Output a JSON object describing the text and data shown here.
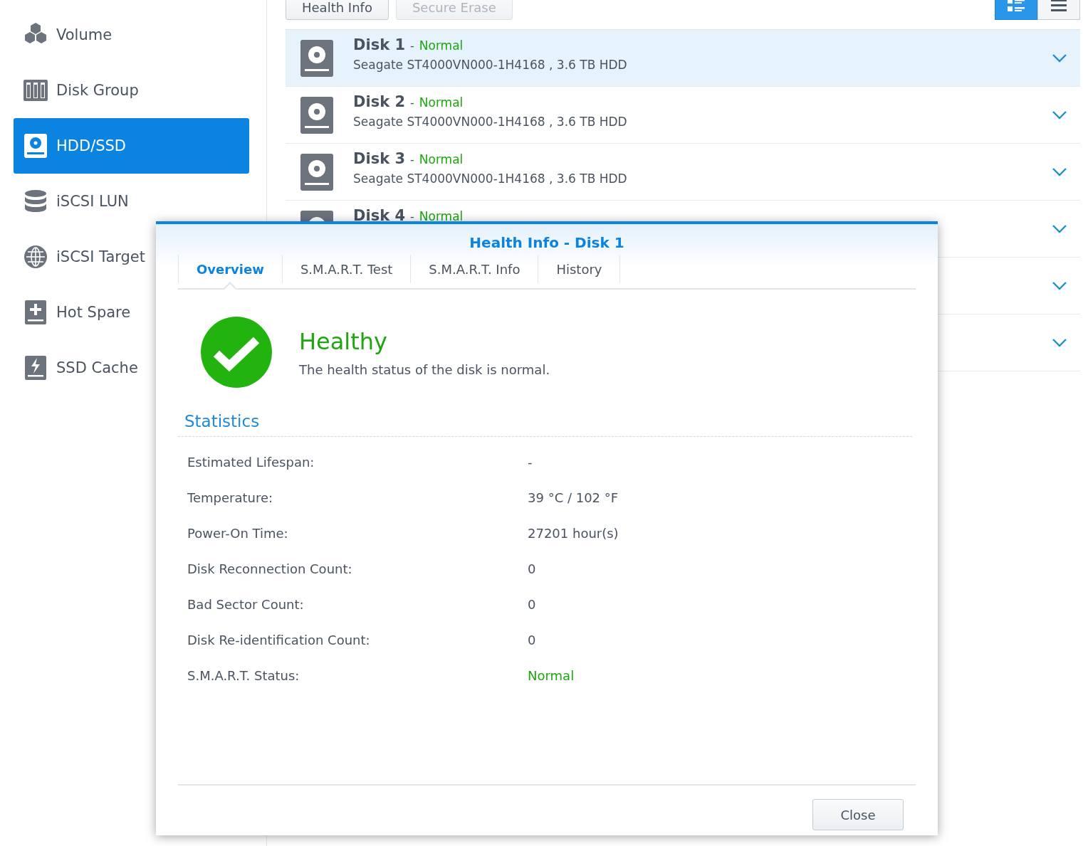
{
  "sidebar": {
    "items": [
      {
        "label": "Volume",
        "kind": "volume",
        "selected": false
      },
      {
        "label": "Disk Group",
        "kind": "group",
        "selected": false
      },
      {
        "label": "HDD/SSD",
        "kind": "hdd",
        "selected": true
      },
      {
        "label": "iSCSI LUN",
        "kind": "lun",
        "selected": false
      },
      {
        "label": "iSCSI Target",
        "kind": "target",
        "selected": false
      },
      {
        "label": "Hot Spare",
        "kind": "spare",
        "selected": false
      },
      {
        "label": "SSD Cache",
        "kind": "cache",
        "selected": false
      }
    ]
  },
  "toolbar": {
    "buttons": [
      {
        "label": "Health Info",
        "disabled": false
      },
      {
        "label": "Secure Erase",
        "disabled": true
      }
    ],
    "view_toggle": [
      {
        "kind": "detail",
        "selected": true
      },
      {
        "kind": "list",
        "selected": false
      }
    ]
  },
  "disks": [
    {
      "name": "Disk 1",
      "separator": "-",
      "status": "Normal",
      "model": "Seagate ST4000VN000-1H4168 , 3.6 TB HDD",
      "selected": true
    },
    {
      "name": "Disk 2",
      "separator": "-",
      "status": "Normal",
      "model": "Seagate ST4000VN000-1H4168 , 3.6 TB HDD",
      "selected": false
    },
    {
      "name": "Disk 3",
      "separator": "-",
      "status": "Normal",
      "model": "Seagate ST4000VN000-1H4168 , 3.6 TB HDD",
      "selected": false
    },
    {
      "name": "Disk 4",
      "separator": "-",
      "status": "Normal",
      "selected": false
    },
    {
      "selected": false
    },
    {
      "selected": false
    }
  ],
  "dialog": {
    "title": "Health Info - Disk 1",
    "tabs": [
      {
        "label": "Overview",
        "selected": true
      },
      {
        "label": "S.M.A.R.T. Test",
        "selected": false
      },
      {
        "label": "S.M.A.R.T. Info",
        "selected": false
      },
      {
        "label": "History",
        "selected": false
      }
    ],
    "health": {
      "title": "Healthy",
      "description": "The health status of the disk is normal."
    },
    "section": "Statistics",
    "stats": [
      {
        "label": "Estimated Lifespan:",
        "value": "-",
        "kind": "plain"
      },
      {
        "label": "Temperature:",
        "value": "39 °C / 102 °F",
        "kind": "plain"
      },
      {
        "label": "Power-On Time:",
        "value": "27201 hour(s)",
        "kind": "plain"
      },
      {
        "label": "Disk Reconnection Count:",
        "value": "0",
        "kind": "plain"
      },
      {
        "label": "Bad Sector Count:",
        "value": "0",
        "kind": "plain"
      },
      {
        "label": "Disk Re-identification Count:",
        "value": "0",
        "kind": "plain"
      },
      {
        "label": "S.M.A.R.T. Status:",
        "value": "Normal",
        "kind": "good"
      }
    ],
    "close_button": "Close"
  }
}
